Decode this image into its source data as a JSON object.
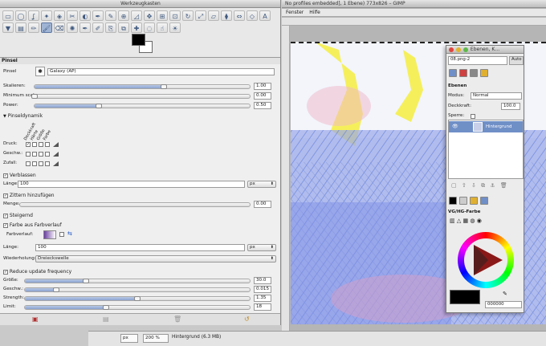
{
  "toolbox": {
    "title": "Werkzeugkasten",
    "tools": [
      "rect-select",
      "ellipse-select",
      "free-select",
      "fuzzy-select",
      "color-select",
      "scissors",
      "foreground-select",
      "paths",
      "color-picker",
      "zoom",
      "measure",
      "move",
      "align",
      "crop",
      "rotate",
      "scale",
      "shear",
      "perspective",
      "flip",
      "cage",
      "text",
      "bucket-fill",
      "blend",
      "pencil",
      "paintbrush",
      "eraser",
      "airbrush",
      "ink",
      "mypaint",
      "clone",
      "perspective-clone",
      "heal",
      "blur",
      "smudge",
      "dodge"
    ]
  },
  "options": {
    "header": "Pinsel",
    "brush_label": "Pinsel",
    "brush_value": "Galaxy (AP)",
    "scale": {
      "label": "Skalieren:",
      "value": "1.00",
      "fraction": 0.6
    },
    "min_scale": {
      "label": "Minimum scale:",
      "value": "0.00",
      "fraction": 0.0
    },
    "power": {
      "label": "Power:",
      "value": "0.50",
      "fraction": 0.3
    },
    "dynamics_label": "Pinseldynamik",
    "dyn_cols": [
      "Deckkraft",
      "Härte",
      "Größe",
      "Farbe"
    ],
    "dyn_rows": [
      "Druck:",
      "Geschw.:",
      "Zufall:"
    ],
    "fade_label": "Verblassen",
    "length_label": "Länge:",
    "length_value": "100",
    "unit": "px",
    "jitter_label": "Zittern hinzufügen",
    "amount_label": "Menge:",
    "amount_value": "0.00",
    "increase_label": "Steigernd",
    "gradient_color_label": "Farbe aus Farbverlauf",
    "gradient_label": "Farbverlauf:",
    "length2_label": "Länge:",
    "length2_value": "100",
    "repeat_label": "Wiederholung:",
    "repeat_value": "Dreieckswelle",
    "reduce_label": "Reduce update frequency",
    "size": {
      "label": "Größe:",
      "value": "30.0",
      "fraction": 0.27
    },
    "speed": {
      "label": "Geschw.:",
      "value": "0.015",
      "fraction": 0.14
    },
    "strength": {
      "label": "Strength:",
      "value": "1.35",
      "fraction": 0.5
    },
    "limit": {
      "label": "Limit:",
      "value": "18",
      "fraction": 0.36
    }
  },
  "image_window": {
    "title": "No profiles embedded], 1 Ebene) 773x826 – GIMP",
    "menu": [
      "Fenster",
      "Hilfe"
    ],
    "status_unit": "px",
    "zoom": "200 %",
    "status_text": "Hintergrund (6.3 MB)"
  },
  "layers": {
    "title": "Ebenen, K…",
    "image_select": "08.png-2",
    "auto_label": "Auto",
    "tab_label": "Ebenen",
    "mode_label": "Modus:",
    "mode_value": "Normal",
    "opacity_label": "Deckkraft:",
    "opacity_value": "100.0",
    "lock_label": "Sperre:",
    "layer_name": "Hintergrund",
    "fgbg_label": "VG/HG-Farbe",
    "hex_value": "000000"
  },
  "colors": {
    "accent": "#6f8fc7",
    "canvas": "#c8cfe8"
  }
}
